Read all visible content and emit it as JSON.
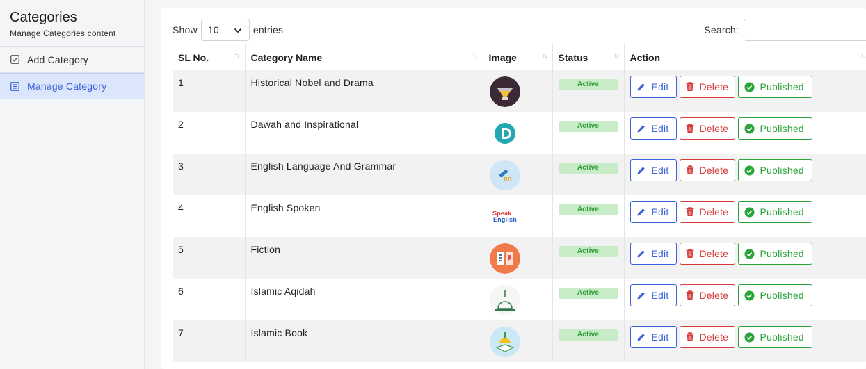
{
  "sidebar": {
    "title": "Categories",
    "subtitle": "Manage Categories content",
    "items": [
      {
        "label": "Add Category",
        "icon": "checkbox-icon",
        "active": false
      },
      {
        "label": "Manage Category",
        "icon": "list-icon",
        "active": true
      }
    ]
  },
  "controls": {
    "show_label": "Show",
    "entries_value": "10",
    "entries_label": "entries",
    "search_label": "Search:",
    "search_value": ""
  },
  "table": {
    "headers": [
      "SL No.",
      "Category Name",
      "Image",
      "Status",
      "Action"
    ],
    "rows": [
      {
        "sl": "1",
        "name": "Historical Nobel and Drama",
        "status": "Active",
        "image": "drama-icon"
      },
      {
        "sl": "2",
        "name": "Dawah and Inspirational",
        "status": "Active",
        "image": "dawah-logo-icon"
      },
      {
        "sl": "3",
        "name": "English Language And Grammar",
        "status": "Active",
        "image": "english-en-icon"
      },
      {
        "sl": "4",
        "name": "English Spoken",
        "status": "Active",
        "image": "speak-english-icon"
      },
      {
        "sl": "5",
        "name": "Fiction",
        "status": "Active",
        "image": "open-book-icon"
      },
      {
        "sl": "6",
        "name": "Islamic Aqidah",
        "status": "Active",
        "image": "mosque-icon"
      },
      {
        "sl": "7",
        "name": "Islamic Book",
        "status": "Active",
        "image": "reading-mosque-icon"
      }
    ],
    "buttons": {
      "edit": "Edit",
      "delete": "Delete",
      "published": "Published"
    }
  },
  "thumb_text": {
    "speak": "Speak",
    "english": "English",
    "en": "en"
  },
  "colors": {
    "accent": "#3d63d8",
    "danger": "#d63b3b",
    "success": "#2aa53a",
    "active_badge_bg": "#c8ebc8",
    "sidebar_active_bg": "#dbe5fb"
  }
}
